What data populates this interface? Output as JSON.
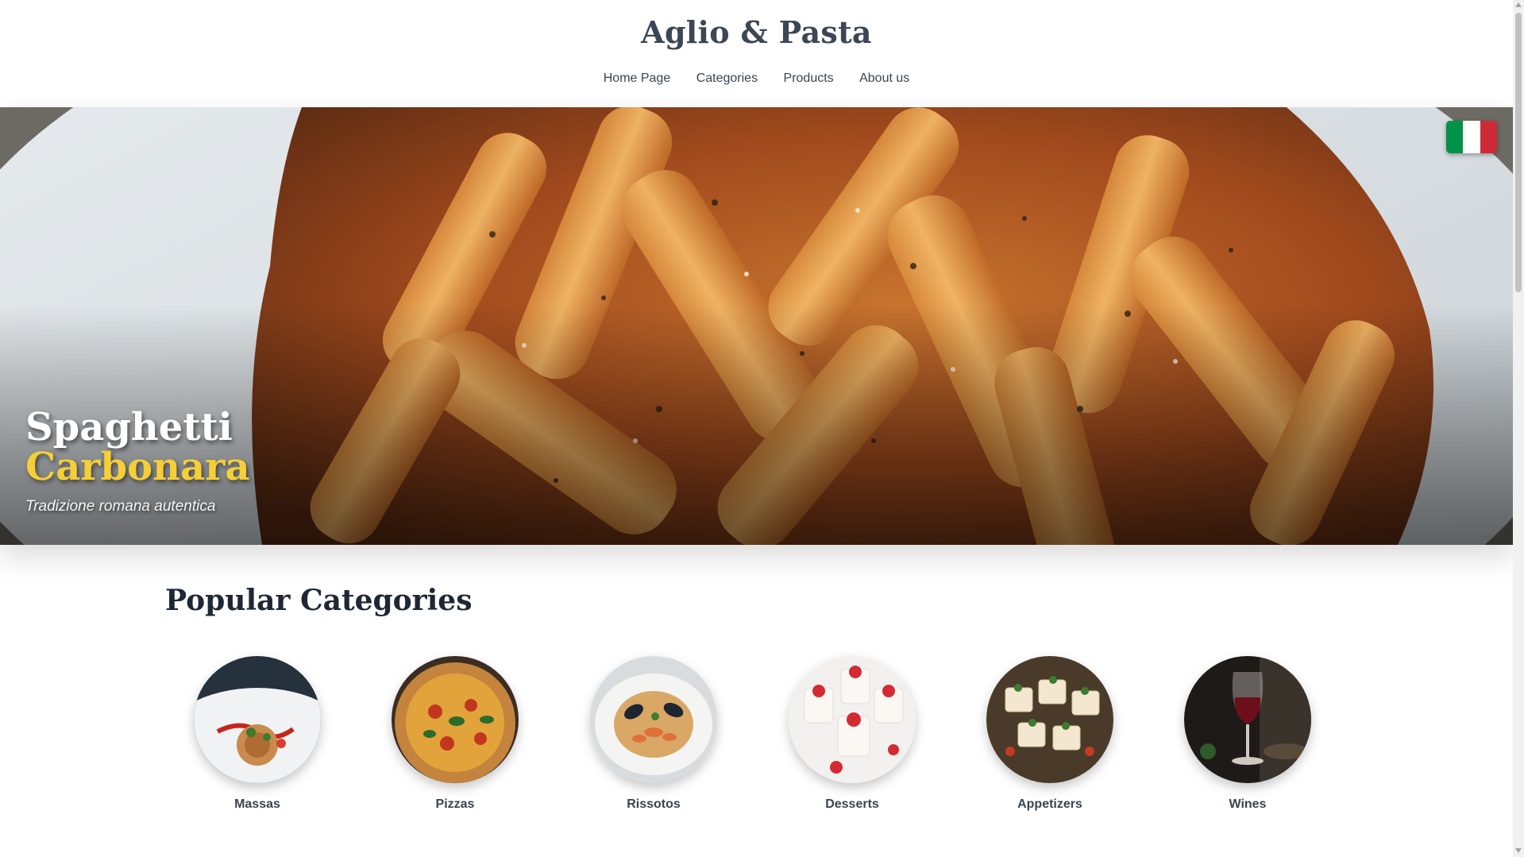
{
  "brand": {
    "logo_text": "Aglio & Pasta"
  },
  "nav": {
    "items": [
      "Home Page",
      "Categories",
      "Products",
      "About us"
    ]
  },
  "hero": {
    "title_line1": "Spaghetti",
    "title_line2": "Carbonara",
    "subtitle": "Tradizione romana autentica",
    "accent_color": "#f6cf36",
    "flag_icon": "italy-flag-icon"
  },
  "categories": {
    "heading": "Popular Categories",
    "items": [
      {
        "label": "Massas",
        "icon": "spaghetti-plate-image"
      },
      {
        "label": "Pizzas",
        "icon": "pizza-image"
      },
      {
        "label": "Rissotos",
        "icon": "seafood-risotto-image"
      },
      {
        "label": "Desserts",
        "icon": "strawberry-dessert-image"
      },
      {
        "label": "Appetizers",
        "icon": "appetizers-image"
      },
      {
        "label": "Wines",
        "icon": "wine-glass-image"
      }
    ]
  },
  "colors": {
    "title_dark": "#1f2735",
    "nav_text": "#3b4450",
    "flag_green": "#009246",
    "flag_white": "#ffffff",
    "flag_red": "#ce2b37"
  }
}
